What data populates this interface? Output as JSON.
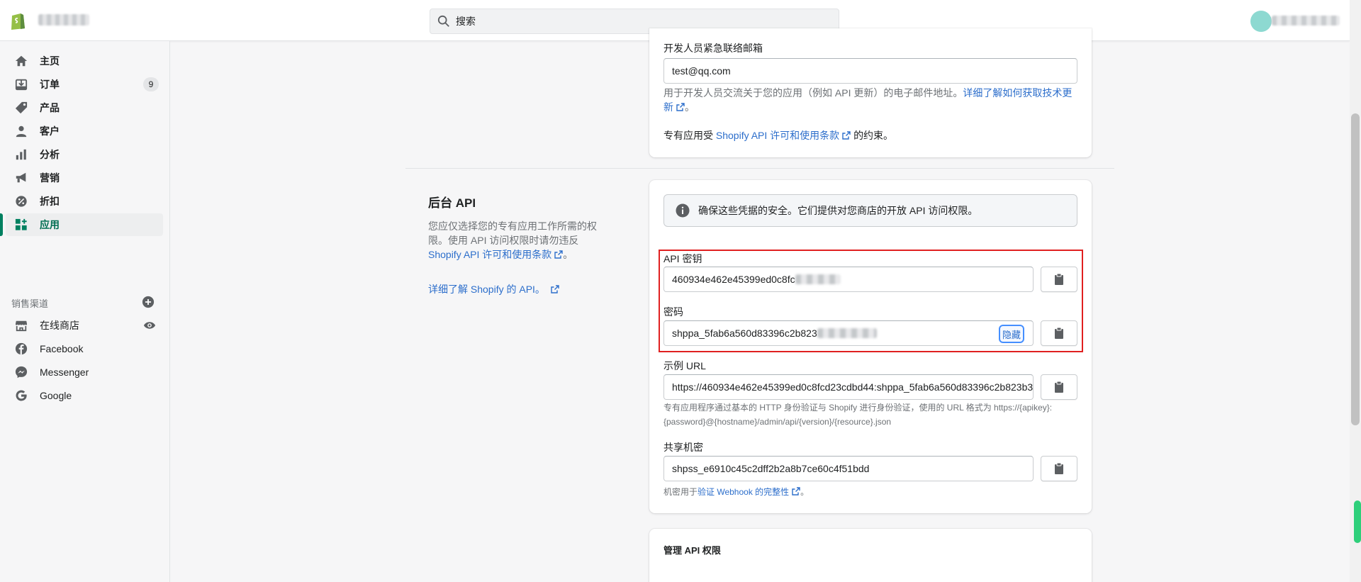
{
  "search": {
    "placeholder": "搜索"
  },
  "sidebar": {
    "items": [
      {
        "label": "主页",
        "icon": "home-icon"
      },
      {
        "label": "订单",
        "icon": "orders-icon",
        "badge": "9"
      },
      {
        "label": "产品",
        "icon": "tag-icon"
      },
      {
        "label": "客户",
        "icon": "person-icon"
      },
      {
        "label": "分析",
        "icon": "bar-chart-icon"
      },
      {
        "label": "营销",
        "icon": "megaphone-icon"
      },
      {
        "label": "折扣",
        "icon": "discount-icon"
      },
      {
        "label": "应用",
        "icon": "apps-icon",
        "active": true
      }
    ],
    "channels_label": "销售渠道",
    "channels": [
      {
        "label": "在线商店",
        "icon": "store-icon"
      },
      {
        "label": "Facebook",
        "icon": "facebook-icon"
      },
      {
        "label": "Messenger",
        "icon": "messenger-icon"
      },
      {
        "label": "Google",
        "icon": "google-icon"
      }
    ]
  },
  "top_card": {
    "email_label": "开发人员紧急联络邮箱",
    "email_value": "test@qq.com",
    "help_text_prefix": "用于开发人员交流关于您的应用（例如 API 更新）的电子邮件地址。",
    "help_link_line1": "详细了解如何获取技术更",
    "help_link_line2": "新",
    "terms_prefix": "专有应用受",
    "terms_link": "Shopify API 许可和使用条款",
    "terms_suffix": "的约束。"
  },
  "admin_api": {
    "title": "后台 API",
    "desc_line1": "您应仅选择您的专有应用工作所需的权",
    "desc_line2": "限。使用 API 访问权限时请勿违反",
    "desc_link": "Shopify API 许可和使用条款",
    "desc_suffix": "。",
    "learn_more": "详细了解 Shopify 的 API。"
  },
  "credentials_card": {
    "banner": "确保这些凭据的安全。它们提供对您商店的开放 API 访问权限。",
    "api_key_label": "API 密钥",
    "api_key_value": "460934e462e45399ed0c8fc",
    "password_label": "密码",
    "password_value": "shppa_5fab6a560d83396c2b823",
    "hide_label": "隐藏",
    "example_url_label": "示例 URL",
    "example_url_value": "https://460934e462e45399ed0c8fcd23cdbd44:shppa_5fab6a560d83396c2b823b3",
    "example_help_line1": "专有应用程序通过基本的 HTTP 身份验证与 Shopify 进行身份验证，使用的 URL 格式为 https://{apikey}:",
    "example_help_line2": "{password}@{hostname}/admin/api/{version}/{resource}.json",
    "shared_secret_label": "共享机密",
    "shared_secret_value": "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",
    "secret_help_prefix": "机密用于",
    "secret_help_link": "验证 Webhook 的完整性",
    "secret_help_suffix": "。"
  },
  "permissions_card": {
    "title": "管理 API 权限"
  },
  "colors": {
    "accent_green": "#008060",
    "link_blue": "#2c6ecb",
    "highlight_red": "#e02020"
  }
}
